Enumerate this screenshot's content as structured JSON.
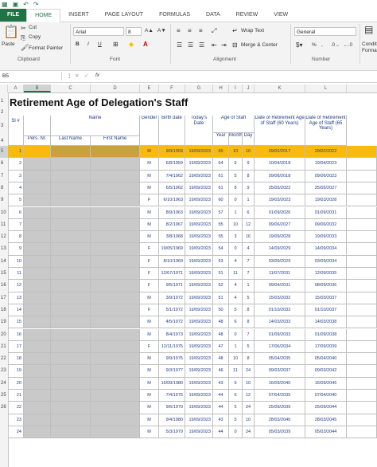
{
  "tabs": [
    "FILE",
    "HOME",
    "INSERT",
    "PAGE LAYOUT",
    "FORMULAS",
    "DATA",
    "REVIEW",
    "VIEW"
  ],
  "ribbon": {
    "clipboard": {
      "paste": "Paste",
      "cut": "Cut",
      "copy": "Copy",
      "format_painter": "Format Painter",
      "label": "Clipboard"
    },
    "font": {
      "name": "Arial",
      "size": "8",
      "bold": "B",
      "italic": "I",
      "underline": "U",
      "label": "Font"
    },
    "alignment": {
      "wrap_text": "Wrap Text",
      "merge_center": "Merge & Center",
      "label": "Alignment"
    },
    "number": {
      "format": "General",
      "percent": "%",
      "comma": ",",
      "label": "Number"
    },
    "cond_format": "Conditional Forma"
  },
  "formula_bar": {
    "name_box": "B5",
    "fx": "fx",
    "value": ""
  },
  "columns": [
    "A",
    "B",
    "C",
    "D",
    "E",
    "F",
    "G",
    "H",
    "I",
    "J",
    "K",
    "L"
  ],
  "sheet": {
    "title": "Retirement Age of Delegation's Staff",
    "headers": {
      "sl": "Sl #",
      "pers": "Pers. Nr.",
      "name": "Name",
      "last": "Last Name",
      "first": "First Name",
      "gender": "Gender",
      "birth": "Birth date",
      "today": "Today's Date",
      "age": "Age of Staff",
      "year": "Year",
      "month": "Month",
      "day": "Day",
      "ret60": "Date of Retirement Age of Staff (60 Years)",
      "ret65": "Date of Retirement Age of Staff (65 Years)"
    },
    "row_numbers": [
      "1",
      "2",
      "3",
      "4",
      "5",
      "6",
      "7",
      "8",
      "9",
      "10",
      "11",
      "12",
      "13",
      "14",
      "15",
      "16",
      "17",
      "18",
      "19",
      "20",
      "21",
      "22",
      "23",
      "24",
      "25",
      "26"
    ],
    "rows": [
      {
        "sl": "1",
        "g": "M",
        "b": "9/9/1959",
        "t": "19/09/2023",
        "y": "65",
        "m": "10",
        "d": "10",
        "r60": "29/02/2017",
        "r65": "29/02/2022"
      },
      {
        "sl": "2",
        "g": "M",
        "b": "6/8/1959",
        "t": "19/09/2023",
        "y": "64",
        "m": "9",
        "d": "9",
        "r60": "10/04/2018",
        "r65": "19/04/2023"
      },
      {
        "sl": "3",
        "g": "M",
        "b": "7/4/1962",
        "t": "19/09/2023",
        "y": "61",
        "m": "5",
        "d": "8",
        "r60": "09/06/2018",
        "r65": "09/06/2023"
      },
      {
        "sl": "4",
        "g": "M",
        "b": "6/5/1962",
        "t": "19/09/2023",
        "y": "61",
        "m": "8",
        "d": "9",
        "r60": "25/05/2022",
        "r65": "25/05/2027"
      },
      {
        "sl": "5",
        "g": "F",
        "b": "6/10/1963",
        "t": "19/09/2023",
        "y": "60",
        "m": "0",
        "d": "1",
        "r60": "19/03/2023",
        "r65": "19/03/2028"
      },
      {
        "sl": "6",
        "g": "M",
        "b": "8/9/1963",
        "t": "19/09/2023",
        "y": "57",
        "m": "1",
        "d": "6",
        "r60": "01/09/2026",
        "r65": "01/09/2031"
      },
      {
        "sl": "7",
        "g": "M",
        "b": "8/2/1967",
        "t": "19/09/2023",
        "y": "55",
        "m": "10",
        "d": "12",
        "r60": "09/06/2027",
        "r65": "09/06/2032"
      },
      {
        "sl": "8",
        "g": "M",
        "b": "3/8/1968",
        "t": "19/09/2023",
        "y": "55",
        "m": "3",
        "d": "16",
        "r60": "19/09/2028",
        "r65": "19/09/2033"
      },
      {
        "sl": "9",
        "g": "F",
        "b": "19/05/1969",
        "t": "19/09/2023",
        "y": "54",
        "m": "0",
        "d": "4",
        "r60": "14/09/2029",
        "r65": "14/09/2034"
      },
      {
        "sl": "10",
        "g": "F",
        "b": "8/10/1969",
        "t": "19/09/2023",
        "y": "53",
        "m": "4",
        "d": "7",
        "r60": "03/09/2029",
        "r65": "03/09/2034"
      },
      {
        "sl": "11",
        "g": "F",
        "b": "12/07/1971",
        "t": "19/09/2023",
        "y": "51",
        "m": "11",
        "d": "7",
        "r60": "11/07/2031",
        "r65": "12/09/2035"
      },
      {
        "sl": "12",
        "g": "F",
        "b": "9/5/1971",
        "t": "19/09/2023",
        "y": "52",
        "m": "4",
        "d": "1",
        "r60": "09/04/2031",
        "r65": "08/09/2036"
      },
      {
        "sl": "13",
        "g": "M",
        "b": "3/9/1972",
        "t": "19/09/2023",
        "y": "51",
        "m": "4",
        "d": "5",
        "r60": "15/03/2032",
        "r65": "15/03/2037"
      },
      {
        "sl": "14",
        "g": "F",
        "b": "5/1/1972",
        "t": "19/09/2023",
        "y": "50",
        "m": "5",
        "d": "8",
        "r60": "01/10/2032",
        "r65": "01/10/2037"
      },
      {
        "sl": "15",
        "g": "M",
        "b": "4/5/1972",
        "t": "19/09/2023",
        "y": "48",
        "m": "6",
        "d": "8",
        "r60": "14/03/2033",
        "r65": "14/03/2038"
      },
      {
        "sl": "16",
        "g": "M",
        "b": "8/4/1973",
        "t": "19/09/2023",
        "y": "48",
        "m": "0",
        "d": "7",
        "r60": "01/09/2033",
        "r65": "01/09/2038"
      },
      {
        "sl": "17",
        "g": "F",
        "b": "12/11/1975",
        "t": "19/09/2023",
        "y": "47",
        "m": "1",
        "d": "5",
        "r60": "17/06/2034",
        "r65": "17/09/2039"
      },
      {
        "sl": "18",
        "g": "M",
        "b": "9/9/1975",
        "t": "19/09/2023",
        "y": "48",
        "m": "10",
        "d": "8",
        "r60": "05/04/2035",
        "r65": "05/04/2040"
      },
      {
        "sl": "19",
        "g": "M",
        "b": "9/3/1977",
        "t": "19/09/2023",
        "y": "46",
        "m": "11",
        "d": "24",
        "r60": "09/03/2037",
        "r65": "09/03/2042"
      },
      {
        "sl": "20",
        "g": "M",
        "b": "16/09/1980",
        "t": "19/09/2023",
        "y": "43",
        "m": "9",
        "d": "10",
        "r60": "16/09/2040",
        "r65": "16/09/2045"
      },
      {
        "sl": "21",
        "g": "M",
        "b": "7/4/1975",
        "t": "19/09/2023",
        "y": "44",
        "m": "6",
        "d": "12",
        "r60": "07/04/2035",
        "r65": "07/04/2040"
      },
      {
        "sl": "22",
        "g": "M",
        "b": "9/6/1979",
        "t": "19/09/2023",
        "y": "44",
        "m": "5",
        "d": "24",
        "r60": "25/09/2039",
        "r65": "25/09/2044"
      },
      {
        "sl": "23",
        "g": "M",
        "b": "9/4/1980",
        "t": "19/09/2023",
        "y": "43",
        "m": "5",
        "d": "10",
        "r60": "28/03/2040",
        "r65": "28/03/2045"
      },
      {
        "sl": "24",
        "g": "M",
        "b": "5/3/1979",
        "t": "19/09/2023",
        "y": "44",
        "m": "0",
        "d": "24",
        "r60": "05/03/2039",
        "r65": "05/03/2044"
      }
    ]
  },
  "colors": {
    "accent": "#217346",
    "highlight": "#f8bb0d",
    "gray": "#c9c9c9",
    "text_blue": "#1f3a8a"
  }
}
